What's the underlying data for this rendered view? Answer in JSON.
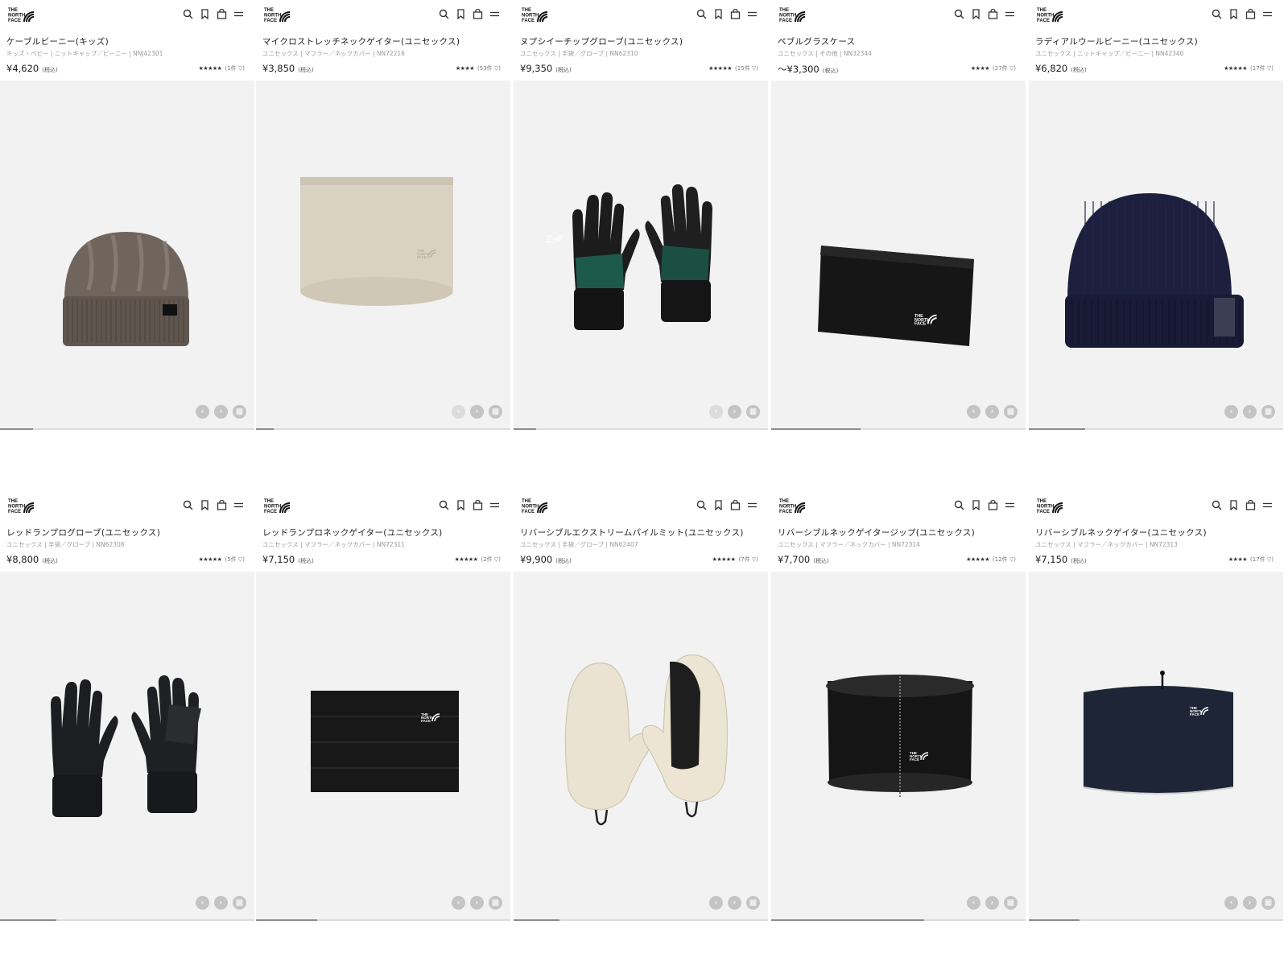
{
  "brand": {
    "logo_line1": "THE",
    "logo_line2": "NORTH",
    "logo_line3": "FACE"
  },
  "header_icons": [
    "search-icon",
    "bookmark-icon",
    "bag-icon",
    "menu-icon"
  ],
  "tax_label": "(税込)",
  "colors": {
    "stage_bg": "#f2f2f2",
    "nav_button": "#c4c4c4",
    "scroll_thumb": "#8c8c8c"
  },
  "products": [
    {
      "name": "ケーブルビーニー(キッズ)",
      "meta": "キッズ・ベビー | ニットキャップ／ビーニー | NNJ42301",
      "price": "¥4,620",
      "stars": "★★★★★",
      "reviews": "(1件 ▽)",
      "art": "beanie-cable",
      "scroll": 0.13
    },
    {
      "name": "マイクロストレッチネックゲイター(ユニセックス)",
      "meta": "ユニセックス | マフラー／ネックカバー | NN72216",
      "price": "¥3,850",
      "stars": "★★★★",
      "reviews": "(53件 ▽)",
      "art": "gaiter-beige",
      "scroll": 0.07
    },
    {
      "name": "ヌプシイーチップグローブ(ユニセックス)",
      "meta": "ユニセックス | 手袋／グローブ | NN62310",
      "price": "¥9,350",
      "stars": "★★★★★",
      "reviews": "(15件 ▽)",
      "art": "gloves-green",
      "scroll": 0.09
    },
    {
      "name": "ペブルグラスケース",
      "meta": "ユニセックス | その他 | NN32344",
      "price": "〜¥3,300",
      "stars": "★★★★",
      "reviews": "(27件 ▽)",
      "art": "glass-case",
      "scroll": 0.35
    },
    {
      "name": "ラディアルウールビーニー(ユニセックス)",
      "meta": "ユニセックス | ニットキャップ／ビーニー | NN42340",
      "price": "¥6,820",
      "stars": "★★★★★",
      "reviews": "(17件 ▽)",
      "art": "beanie-navy",
      "scroll": 0.22
    },
    {
      "name": "レッドランプログローブ(ユニセックス)",
      "meta": "ユニセックス | 手袋／グローブ | NN62308",
      "price": "¥8,800",
      "stars": "★★★★★",
      "reviews": "(5件 ▽)",
      "art": "gloves-black",
      "scroll": 0.22
    },
    {
      "name": "レッドランプロネックゲイター(ユニセックス)",
      "meta": "ユニセックス | マフラー／ネックカバー | NN72311",
      "price": "¥7,150",
      "stars": "★★★★★",
      "reviews": "(2件 ▽)",
      "art": "gaiter-black",
      "scroll": 0.24
    },
    {
      "name": "リバーシブルエクストリームパイルミット(ユニセックス)",
      "meta": "ユニセックス | 手袋／グローブ | NN62407",
      "price": "¥9,900",
      "stars": "★★★★★",
      "reviews": "(7件 ▽)",
      "art": "mitts-pile",
      "scroll": 0.18
    },
    {
      "name": "リバーシブルネックゲイタージップ(ユニセックス)",
      "meta": "ユニセックス | マフラー／ネックカバー | NN72314",
      "price": "¥7,700",
      "stars": "★★★★★",
      "reviews": "(12件 ▽)",
      "art": "gaiter-zip",
      "scroll": 0.6
    },
    {
      "name": "リバーシブルネックゲイター(ユニセックス)",
      "meta": "ユニセックス | マフラー／ネックカバー | NN72313",
      "price": "¥7,150",
      "stars": "★★★★",
      "reviews": "(17件 ▽)",
      "art": "gaiter-navy",
      "scroll": 0.2
    }
  ]
}
